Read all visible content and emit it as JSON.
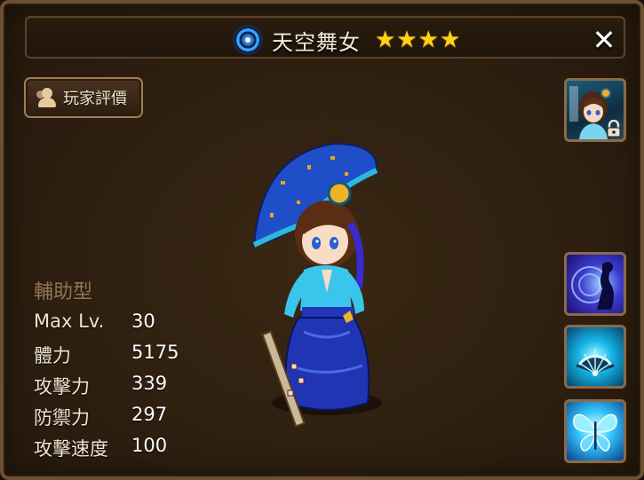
{
  "header": {
    "monster_name": "天空舞女",
    "stars": 4,
    "star_glyph": "★",
    "element": "water",
    "close_label": "✕"
  },
  "review_button": {
    "label": "玩家評價",
    "icon": "people-icon"
  },
  "portrait": {
    "icon": "monster-portrait",
    "locked": true
  },
  "skills": [
    {
      "icon": "skill-1-silhouette-icon"
    },
    {
      "icon": "skill-2-fan-icon"
    },
    {
      "icon": "skill-3-butterfly-icon"
    }
  ],
  "stats": {
    "type": "輔助型",
    "rows": [
      {
        "label": "Max Lv.",
        "value": "30"
      },
      {
        "label": "體力",
        "value": "5175"
      },
      {
        "label": "攻擊力",
        "value": "339"
      },
      {
        "label": "防禦力",
        "value": "297"
      },
      {
        "label": "攻擊速度",
        "value": "100"
      }
    ]
  },
  "colors": {
    "accent_star": "#ffd21a",
    "panel_border": "#6b5134",
    "label_muted": "#8f7554"
  }
}
